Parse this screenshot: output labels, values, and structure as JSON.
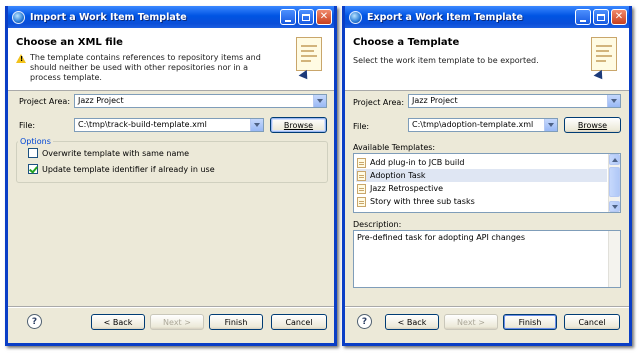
{
  "import_dialog": {
    "title": "Import a Work Item Template",
    "banner_title": "Choose an XML file",
    "banner_message": "The template contains references to repository items and should neither be used with other repositories nor in a process template.",
    "project_area_label": "Project Area:",
    "project_area_value": "Jazz Project",
    "file_label": "File:",
    "file_value": "C:\\tmp\\track-build-template.xml",
    "browse_label": "Browse",
    "options_label": "Options",
    "option_overwrite_label": "Overwrite template with same name",
    "option_overwrite_checked": false,
    "option_update_label": "Update template identifier if already in use",
    "option_update_checked": true,
    "back_label": "< Back",
    "next_label": "Next >",
    "finish_label": "Finish",
    "cancel_label": "Cancel",
    "help_glyph": "?"
  },
  "export_dialog": {
    "title": "Export a Work Item Template",
    "banner_title": "Choose a Template",
    "banner_message": "Select the work item template to be exported.",
    "project_area_label": "Project Area:",
    "project_area_value": "Jazz Project",
    "file_label": "File:",
    "file_value": "C:\\tmp\\adoption-template.xml",
    "browse_label": "Browse",
    "available_label": "Available Templates:",
    "templates": [
      {
        "label": "Add plug-in to JCB build",
        "selected": false
      },
      {
        "label": "Adoption Task",
        "selected": true
      },
      {
        "label": "Jazz Retrospective",
        "selected": false
      },
      {
        "label": "Story with three sub tasks",
        "selected": false
      }
    ],
    "description_label": "Description:",
    "description_value": "Pre-defined task for adopting API changes",
    "back_label": "< Back",
    "next_label": "Next >",
    "finish_label": "Finish",
    "cancel_label": "Cancel",
    "help_glyph": "?"
  },
  "window_buttons": {
    "minimize": "minimize-icon",
    "maximize": "maximize-icon",
    "close": "close-icon",
    "close_glyph": "✕"
  },
  "colors": {
    "title_blue": "#0054e3",
    "dialog_bg": "#ece9d8",
    "group_title": "#0046d5"
  }
}
